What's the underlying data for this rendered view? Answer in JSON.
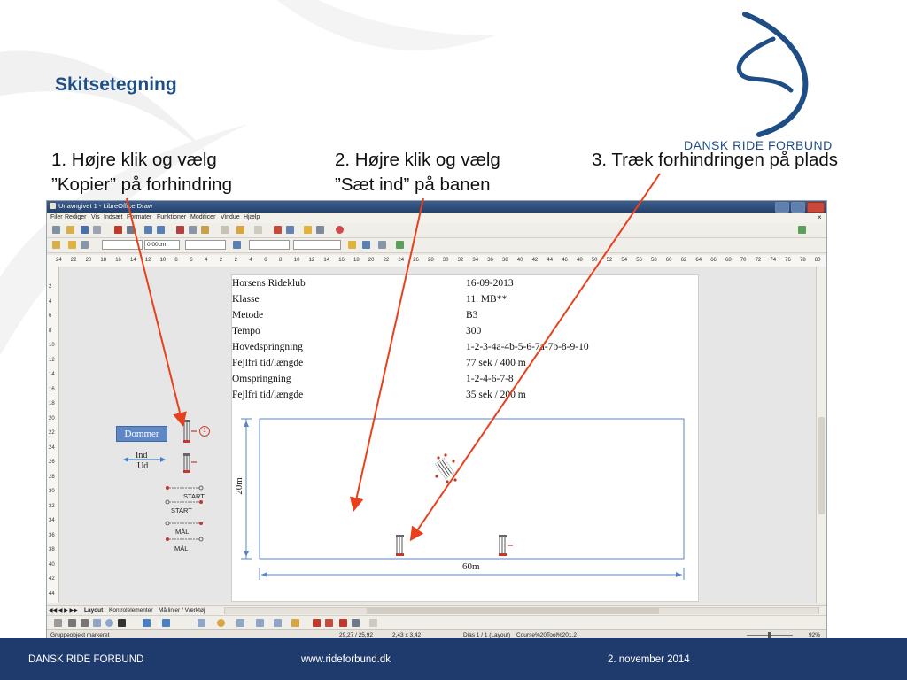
{
  "slide": {
    "title": "Skitsetegning",
    "steps": [
      "1. Højre klik og vælg\n”Kopier” på forhindring",
      "2. Højre klik og vælg\n”Sæt ind” på banen",
      "3. Træk forhindringen på plads"
    ],
    "logo_text": "DANSK RIDE FORBUND",
    "footer": {
      "org": "DANSK RIDE FORBUND",
      "url": "www.rideforbund.dk",
      "date": "2. november 2014"
    },
    "arrow_color": "#e8401c",
    "brand_color": "#1f4e86"
  },
  "app": {
    "title": "Unavngivet 1 - LibreOffice Draw",
    "menu": [
      "Filer",
      "Rediger",
      "Vis",
      "Indsæt",
      "Formater",
      "Funktioner",
      "Modificer",
      "Vindue",
      "Hjælp"
    ],
    "line_width": "0,00cm",
    "ruler_h": [
      "24",
      "22",
      "20",
      "18",
      "16",
      "14",
      "12",
      "10",
      "8",
      "6",
      "4",
      "2",
      "2",
      "4",
      "6",
      "8",
      "10",
      "12",
      "14",
      "16",
      "18",
      "20",
      "22",
      "24",
      "26",
      "28",
      "30",
      "32",
      "34",
      "36",
      "38",
      "40",
      "42",
      "44",
      "46",
      "48",
      "50",
      "52",
      "54",
      "56",
      "58",
      "60",
      "62",
      "64",
      "66",
      "68",
      "70",
      "72",
      "74",
      "76",
      "78",
      "80",
      "82"
    ],
    "ruler_v": [
      "2",
      "4",
      "6",
      "8",
      "10",
      "12",
      "14",
      "16",
      "18",
      "20",
      "22",
      "24",
      "26",
      "28",
      "30",
      "32",
      "34",
      "36",
      "38",
      "40",
      "42",
      "44"
    ],
    "info_rows": [
      {
        "label": "Horsens Rideklub",
        "value": "16-09-2013"
      },
      {
        "label": "Klasse",
        "value": "11. MB**"
      },
      {
        "label": "Metode",
        "value": "B3"
      },
      {
        "label": "Tempo",
        "value": "300"
      },
      {
        "label": "Hovedspringning",
        "value": "1-2-3-4a-4b-5-6-7a-7b-8-9-10"
      },
      {
        "label": "Fejlfri tid/længde",
        "value": "77 sek / 400 m"
      },
      {
        "label": "Omspringning",
        "value": "1-2-4-6-7-8"
      },
      {
        "label": "Fejlfri tid/længde",
        "value": "35 sek / 200 m"
      }
    ],
    "arena": {
      "height_label": "20m",
      "width_label": "60m"
    },
    "palette": {
      "judge": "Dommer",
      "in": "Ind",
      "out": "Ud",
      "start1": "START",
      "start2": "START",
      "finish1": "MÅL",
      "finish2": "MÅL",
      "obstacle_number": "1"
    },
    "tabs": [
      "Layout",
      "Kontrolelementer",
      "Mållinjer / Værktøj"
    ],
    "status": {
      "left": "Gruppeobjekt markeret",
      "pos": "29,27 / 25,92",
      "size": "2,43 x 3,42",
      "slide": "Dias 1 / 1 (Layout)",
      "layout": "Course%20Tool%201.2",
      "zoom": "92%"
    }
  }
}
